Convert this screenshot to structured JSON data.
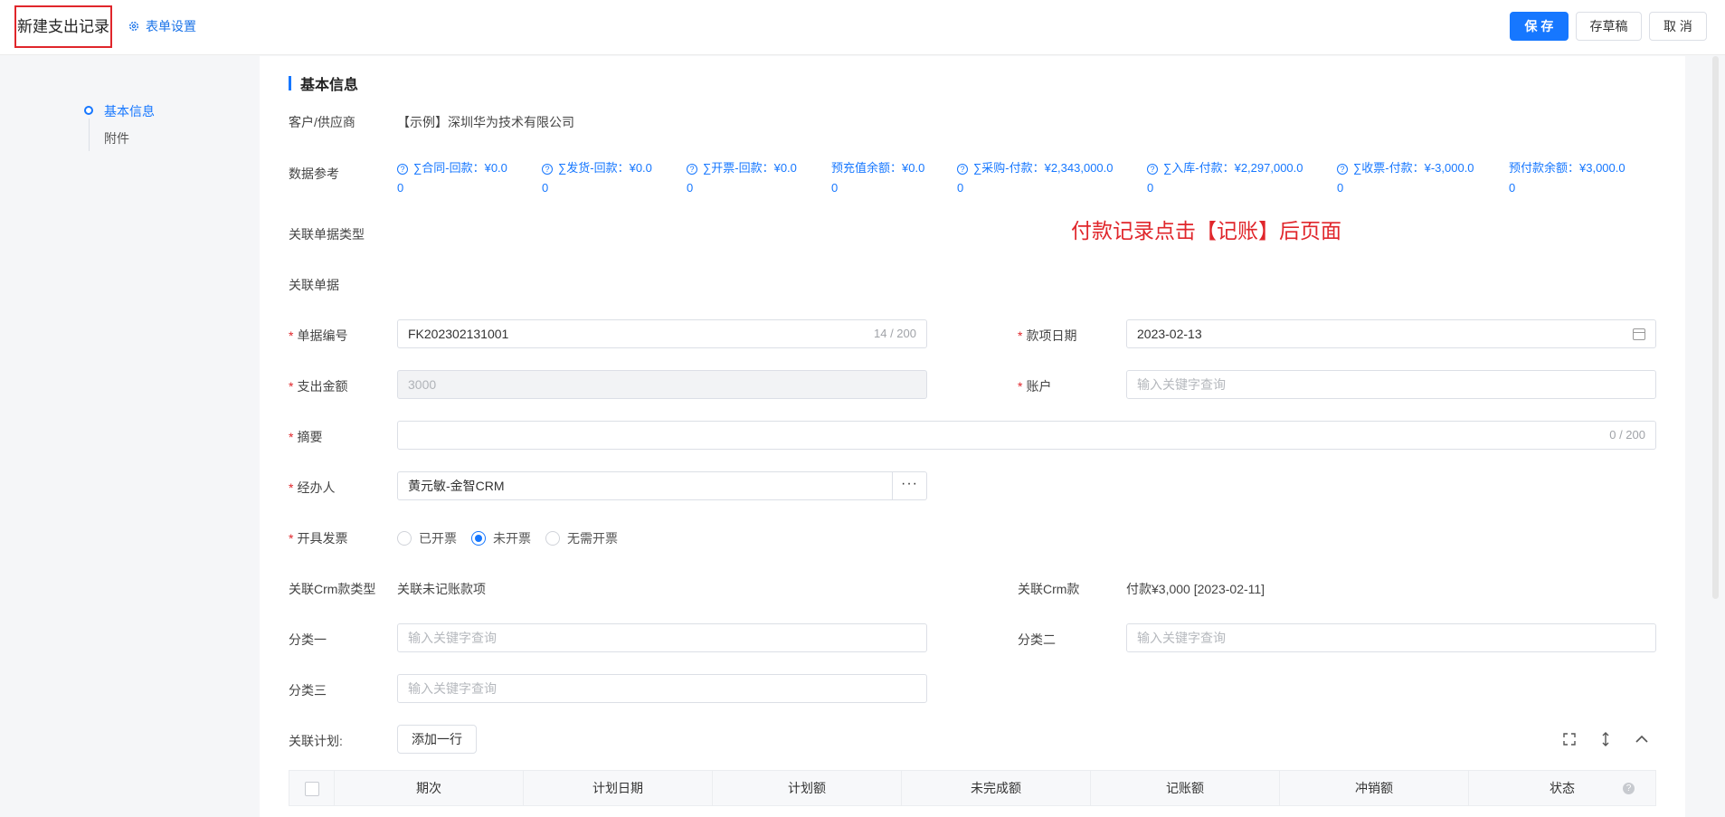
{
  "header": {
    "title": "新建支出记录",
    "form_settings": "表单设置",
    "save": "保 存",
    "draft": "存草稿",
    "cancel": "取 消"
  },
  "nav": {
    "items": [
      {
        "label": "基本信息",
        "active": true
      },
      {
        "label": "附件",
        "active": false
      }
    ]
  },
  "section": {
    "title": "基本信息"
  },
  "annotation": "付款记录点击【记账】后页面",
  "fields": {
    "customer": {
      "label": "客户/供应商",
      "value": "【示例】深圳华为技术有限公司"
    },
    "data_ref": {
      "label": "数据参考",
      "items": [
        {
          "line1": "∑合同-回款：¥0.0",
          "line2": "0",
          "icon": "question-icon"
        },
        {
          "line1": "∑发货-回款：¥0.0",
          "line2": "0",
          "icon": "question-icon"
        },
        {
          "line1": "∑开票-回款：¥0.0",
          "line2": "0",
          "icon": "question-icon"
        },
        {
          "line1": "预充值余额：¥0.0",
          "line2": "0",
          "icon": ""
        },
        {
          "line1": "∑采购-付款：¥2,343,000.0",
          "line2": "0",
          "icon": "question-icon"
        },
        {
          "line1": "∑入库-付款：¥2,297,000.0",
          "line2": "0",
          "icon": "question-icon"
        },
        {
          "line1": "∑收票-付款：¥-3,000.0",
          "line2": "0",
          "icon": "question-icon"
        },
        {
          "line1": "预付款余额：¥3,000.0",
          "line2": "0",
          "icon": ""
        }
      ]
    },
    "linked_doc_type": {
      "label": "关联单据类型"
    },
    "linked_doc": {
      "label": "关联单据"
    },
    "doc_no": {
      "label": "单据编号",
      "value": "FK202302131001",
      "count": "14 / 200"
    },
    "pay_date": {
      "label": "款项日期",
      "value": "2023-02-13"
    },
    "amount": {
      "label": "支出金额",
      "value": "3000"
    },
    "account": {
      "label": "账户",
      "placeholder": "输入关键字查询"
    },
    "summary": {
      "label": "摘要",
      "count": "0 / 200"
    },
    "handler": {
      "label": "经办人",
      "value": "黄元敏-金智CRM",
      "more": "···"
    },
    "invoice": {
      "label": "开具发票",
      "options": [
        {
          "label": "已开票",
          "checked": false
        },
        {
          "label": "未开票",
          "checked": true
        },
        {
          "label": "无需开票",
          "checked": false
        }
      ]
    },
    "crm_type": {
      "label": "关联Crm款类型",
      "value": "关联未记账款项"
    },
    "crm_item": {
      "label": "关联Crm款",
      "value": "付款¥3,000 [2023-02-11]"
    },
    "cat1": {
      "label": "分类一",
      "placeholder": "输入关键字查询"
    },
    "cat2": {
      "label": "分类二",
      "placeholder": "输入关键字查询"
    },
    "cat3": {
      "label": "分类三",
      "placeholder": "输入关键字查询"
    }
  },
  "plan": {
    "label": "关联计划:",
    "add_row": "添加一行",
    "icons": [
      "fullscreen-icon",
      "resize-icon",
      "collapse-icon"
    ],
    "columns": [
      "期次",
      "计划日期",
      "计划额",
      "未完成额",
      "记账额",
      "冲销额",
      "状态"
    ]
  }
}
